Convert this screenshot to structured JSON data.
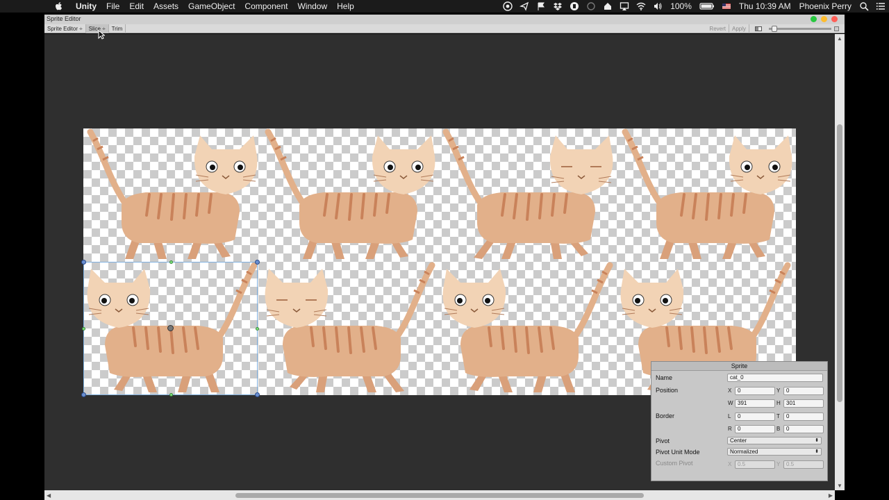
{
  "menubar": {
    "apple_icon": "apple-icon",
    "items": [
      "Unity",
      "File",
      "Edit",
      "Assets",
      "GameObject",
      "Component",
      "Window",
      "Help"
    ],
    "status": {
      "battery": "100%",
      "time": "Thu 10:39 AM",
      "user": "Phoenix Perry"
    }
  },
  "window": {
    "title": "Sprite Editor",
    "close_color": "#ff5f57",
    "minimize_color": "#febc2e",
    "zoom_color": "#28c840"
  },
  "toolbar": {
    "mode": "Sprite Editor ÷",
    "slice": "Slice ÷",
    "trim": "Trim",
    "revert": "Revert",
    "apply": "Apply"
  },
  "sprite_panel": {
    "title": "Sprite",
    "name_label": "Name",
    "name_value": "cat_0",
    "position_label": "Position",
    "x_label": "X",
    "x_value": "0",
    "y_label": "Y",
    "y_value": "0",
    "w_label": "W",
    "w_value": "391",
    "h_label": "H",
    "h_value": "301",
    "border_label": "Border",
    "l_label": "L",
    "l_value": "0",
    "t_label": "T",
    "t_value": "0",
    "r_label": "R",
    "r_value": "0",
    "b_label": "B",
    "b_value": "0",
    "pivot_label": "Pivot",
    "pivot_value": "Center",
    "pivot_unit_label": "Pivot Unit Mode",
    "pivot_unit_value": "Normalized",
    "custom_pivot_label": "Custom Pivot",
    "cx_label": "X",
    "cx_value": "0.5",
    "cy_label": "Y",
    "cy_value": "0.5"
  },
  "colors": {
    "canvas_bg": "#2f2f2f",
    "cat_body": "#e2b08a",
    "cat_face": "#f2d3b5",
    "cat_stripe": "#c9825a",
    "selection": "#7fb0e0"
  }
}
